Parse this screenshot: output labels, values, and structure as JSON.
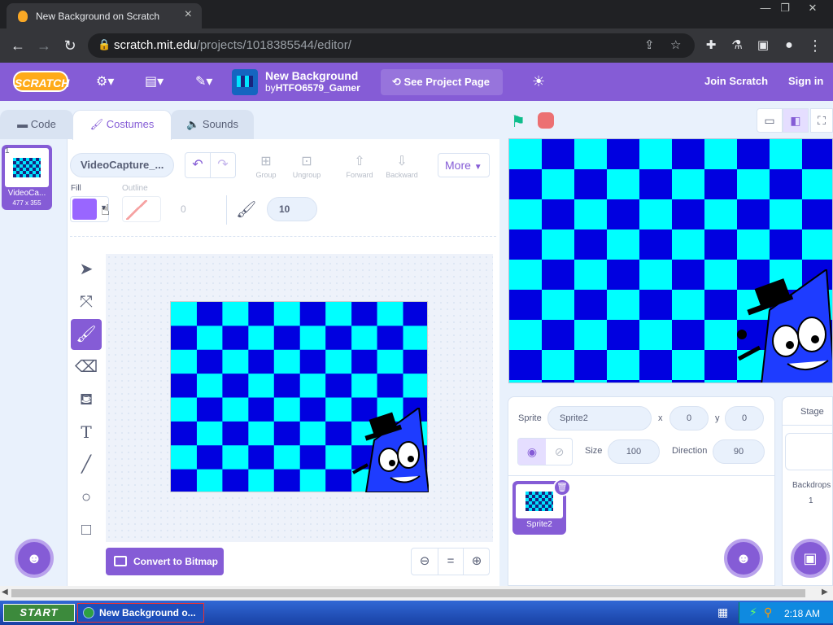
{
  "browser": {
    "tab_title": "New Background on Scratch",
    "url_host": "scratch.mit.edu",
    "url_path": "/projects/1018385544/editor/"
  },
  "menubar": {
    "logo_text": "SCRATCH",
    "project_title": "New Background",
    "by_prefix": "by",
    "author": "HTFO6579_Gamer",
    "see_project_page": "See Project Page",
    "join": "Join Scratch",
    "sign_in": "Sign in"
  },
  "tabs": {
    "code": "Code",
    "costumes": "Costumes",
    "sounds": "Sounds"
  },
  "costume_list": {
    "items": [
      {
        "number": "1",
        "name": "VideoCa...",
        "size": "477 x 355"
      }
    ]
  },
  "paint_editor": {
    "costume_name": "VideoCapture_...",
    "group": "Group",
    "ungroup": "Ungroup",
    "forward": "Forward",
    "backward": "Backward",
    "more": "More",
    "fill_label": "Fill",
    "outline_label": "Outline",
    "outline_width": "0",
    "brush_size": "10",
    "fill_color": "#9966ff",
    "convert_button": "Convert to Bitmap"
  },
  "sprite_info": {
    "sprite_label": "Sprite",
    "sprite_name": "Sprite2",
    "x_label": "x",
    "x_value": "0",
    "y_label": "y",
    "y_value": "0",
    "size_label": "Size",
    "size_value": "100",
    "direction_label": "Direction",
    "direction_value": "90"
  },
  "sprites": [
    {
      "name": "Sprite2"
    }
  ],
  "stage_panel": {
    "title": "Stage",
    "backdrops_label": "Backdrops",
    "backdrops_count": "1"
  },
  "taskbar": {
    "start": "START",
    "task_title": "New Background o...",
    "clock": "2:18 AM"
  },
  "colors": {
    "scratch_purple": "#855cd6",
    "checker_dark": "#0000e0",
    "checker_light": "#00ffff"
  }
}
